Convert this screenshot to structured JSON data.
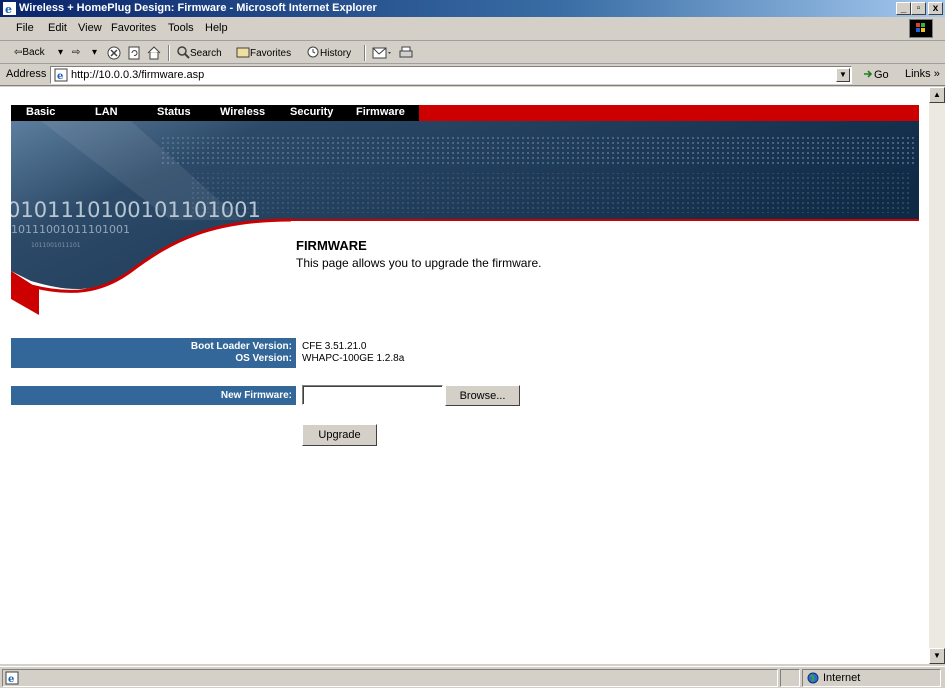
{
  "window": {
    "title": "Wireless + HomePlug Design: Firmware - Microsoft Internet Explorer",
    "controls": {
      "minimize": "_",
      "maximize": "▫",
      "close": "x"
    }
  },
  "menu": {
    "items": [
      "File",
      "Edit",
      "View",
      "Favorites",
      "Tools",
      "Help"
    ]
  },
  "toolbar": {
    "back": "⇦Back",
    "forward": "⇨",
    "search": "Search",
    "favorites": "Favorites",
    "history": "History"
  },
  "address": {
    "label": "Address",
    "url": "http://10.0.0.3/firmware.asp",
    "go": "Go",
    "links": "Links"
  },
  "nav": {
    "items": [
      "Basic",
      "LAN",
      "Status",
      "Wireless",
      "Security",
      "Firmware"
    ]
  },
  "banner": {
    "binary_line1": "0101110100101101001",
    "binary_line2": "10111001011101001",
    "binary_line3": "1011001011101"
  },
  "page": {
    "heading": "FIRMWARE",
    "description": "This page allows you to upgrade the firmware."
  },
  "info": {
    "boot_loader_label": "Boot Loader Version:",
    "boot_loader_value": "CFE 3.51.21.0",
    "os_label": "OS Version:",
    "os_value": "WHAPC-100GE 1.2.8a"
  },
  "firmware_form": {
    "label": "New Firmware:",
    "value": "",
    "browse_label": "Browse...",
    "upgrade_label": "Upgrade"
  },
  "statusbar": {
    "zone": "Internet"
  },
  "colors": {
    "nav_active": "#cc0000",
    "bar_blue": "#336699",
    "banner_dark": "#0f2a45"
  }
}
